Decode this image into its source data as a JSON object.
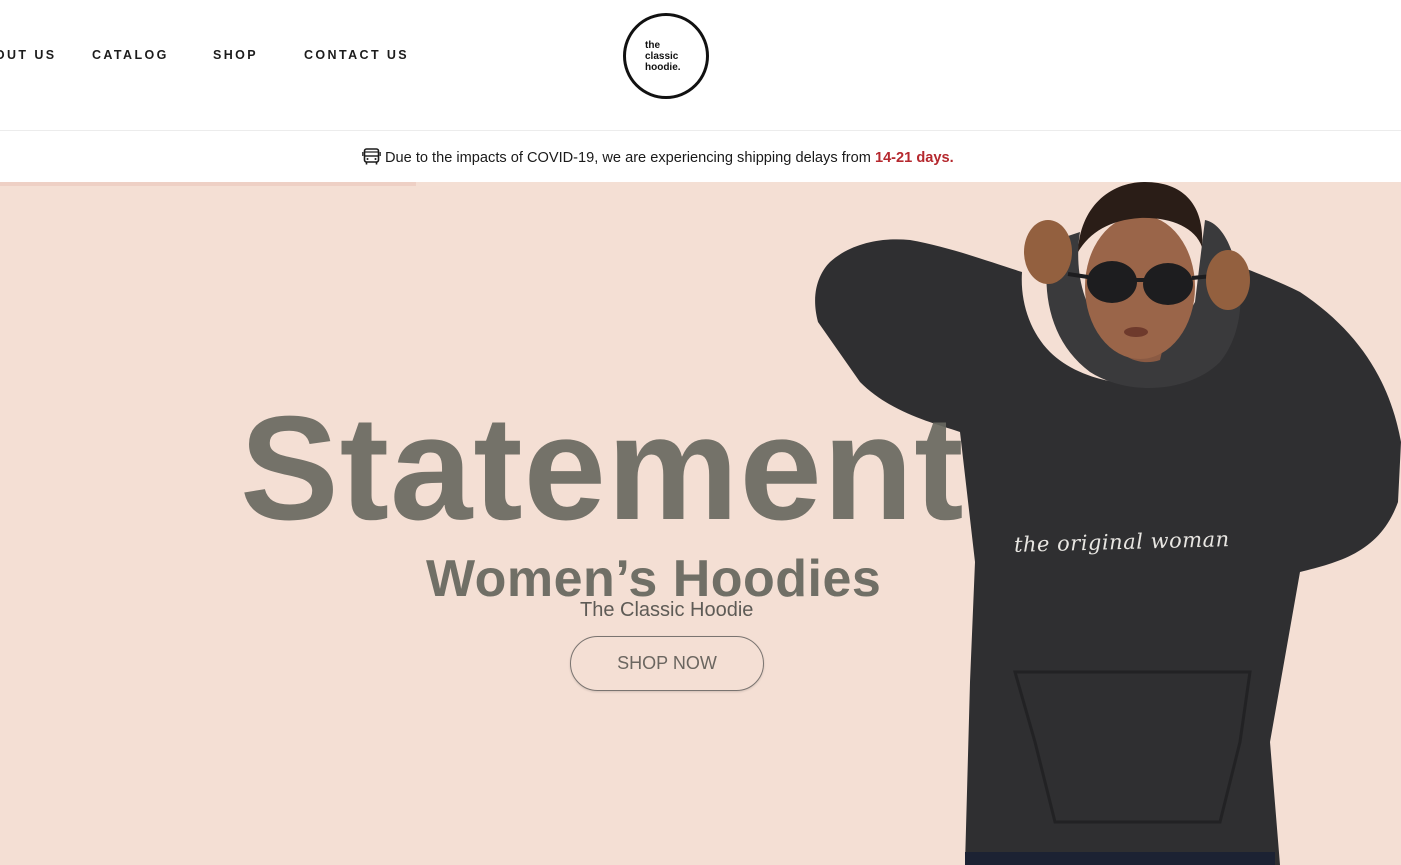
{
  "header": {
    "nav": [
      {
        "label": "ABOUT US"
      },
      {
        "label": "CATALOG"
      },
      {
        "label": "SHOP"
      },
      {
        "label": "CONTACT US"
      }
    ],
    "logo": {
      "lines": [
        "the",
        "classic",
        "hoodie."
      ]
    }
  },
  "announcement": {
    "icon": "bus-icon",
    "text": "Due to the impacts of COVID-19, we are experiencing shipping delays from ",
    "highlight": "14-21 days.",
    "highlight_color": "#b5282e"
  },
  "hero": {
    "title": "Statement",
    "subtitle": "Women’s Hoodies",
    "brand": "The Classic Hoodie",
    "cta_label": "SHOP NOW",
    "shirt_print": "the original woman",
    "background_color": "#f4dfd4",
    "text_color": "#686860"
  }
}
